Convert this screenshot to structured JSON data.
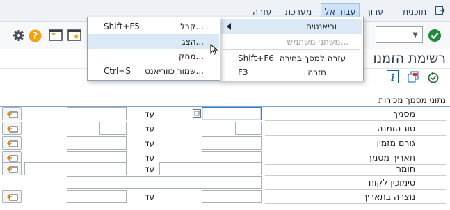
{
  "menubar": {
    "items": [
      {
        "id": "program",
        "label": "תוכנית"
      },
      {
        "id": "edit",
        "label": "ערוך"
      },
      {
        "id": "goto",
        "label": "עבור אל"
      },
      {
        "id": "system",
        "label": "מערכת"
      },
      {
        "id": "help",
        "label": "עזרה"
      }
    ]
  },
  "page": {
    "title": "רשימת הזמנו"
  },
  "section": {
    "title": "נתוני מסמך מכירות",
    "to_label": "עד",
    "rows": [
      {
        "id": "document",
        "label": "מסמך"
      },
      {
        "id": "order-type",
        "label": "סוג הזמנה"
      },
      {
        "id": "orderer",
        "label": "גורם מזמין"
      },
      {
        "id": "doc-date",
        "label": "תאריך מסמך"
      },
      {
        "id": "material",
        "label": "חומר"
      },
      {
        "id": "customer-ref",
        "label": "סימוכין לקוח"
      },
      {
        "id": "created-on",
        "label": "נוצרה בתאריך"
      }
    ]
  },
  "goto_menu": {
    "items": [
      {
        "label": "וריאנטים",
        "shortcut": ""
      },
      {
        "label": "משתני משתמש...",
        "shortcut": ""
      },
      {
        "label": "עזרה למסך בחירה",
        "shortcut": "Shift+F6"
      },
      {
        "label": "חזרה",
        "shortcut": "F3"
      }
    ]
  },
  "variants_submenu": {
    "items": [
      {
        "label": "קבל...",
        "shortcut": "Shift+F5"
      },
      {
        "label": "הצג...",
        "shortcut": ""
      },
      {
        "label": "מחק...",
        "shortcut": ""
      },
      {
        "label": "שמור כווריאנט...",
        "shortcut": "Ctrl+S"
      }
    ]
  },
  "colors": {
    "accent": "#1a73c8",
    "ok_green": "#1e8a3c",
    "help_orange": "#f0a30a"
  }
}
